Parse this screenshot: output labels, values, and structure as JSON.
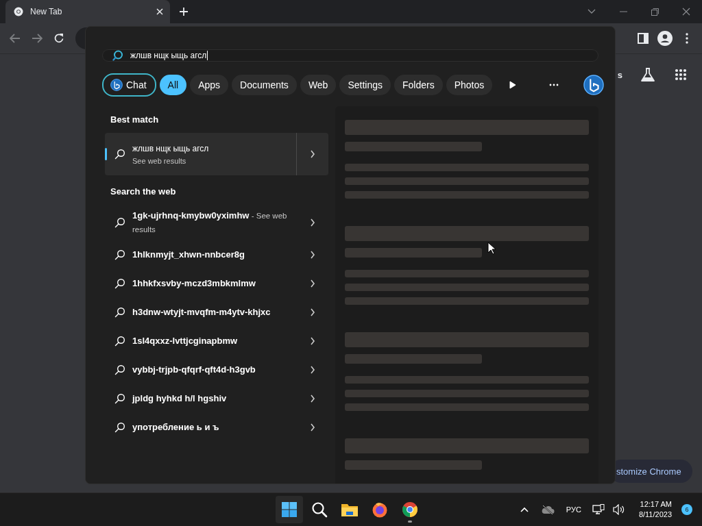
{
  "browser": {
    "tab": {
      "title": "New Tab"
    },
    "toolbar_partial_text": "s",
    "customize_button": "stomize Chrome"
  },
  "search": {
    "query": "жлшв нщк ыщь агсл",
    "chat_label": "Chat",
    "filters": [
      {
        "label": "All",
        "selected": true
      },
      {
        "label": "Apps",
        "selected": false
      },
      {
        "label": "Documents",
        "selected": false
      },
      {
        "label": "Web",
        "selected": false
      },
      {
        "label": "Settings",
        "selected": false
      },
      {
        "label": "Folders",
        "selected": false
      },
      {
        "label": "Photos",
        "selected": false
      }
    ],
    "best_match": {
      "heading": "Best match",
      "title": "жлшв нщк ыщь агсл",
      "subtitle": "See web results"
    },
    "web": {
      "heading": "Search the web",
      "results": [
        {
          "text": "1gk-ujrhnq-kmybw0yximhw",
          "suffix": "- See web results"
        },
        {
          "text": "1hlknmyjt_xhwn-nnbcer8g"
        },
        {
          "text": "1hhkfxsvby-mczd3mbkmlmw"
        },
        {
          "text": "h3dnw-wtyjt-mvqfm-m4ytv-khjxc"
        },
        {
          "text": "1sl4qxxz-lvttjcginapbmw"
        },
        {
          "text": "vybbj-trjpb-qfqrf-qft4d-h3gvb"
        },
        {
          "text": "jpldg hyhkd h/l hgshiv"
        },
        {
          "text": "употребление ь и ъ"
        }
      ]
    }
  },
  "taskbar": {
    "apps": [
      {
        "kind": "start",
        "running": false
      },
      {
        "kind": "search",
        "running": false
      },
      {
        "kind": "explorer",
        "running": false
      },
      {
        "kind": "firefox",
        "running": false
      },
      {
        "kind": "chrome",
        "running": true
      }
    ],
    "language": "РУС",
    "time": "12:17 AM",
    "date": "8/11/2023",
    "notifications": "6"
  }
}
